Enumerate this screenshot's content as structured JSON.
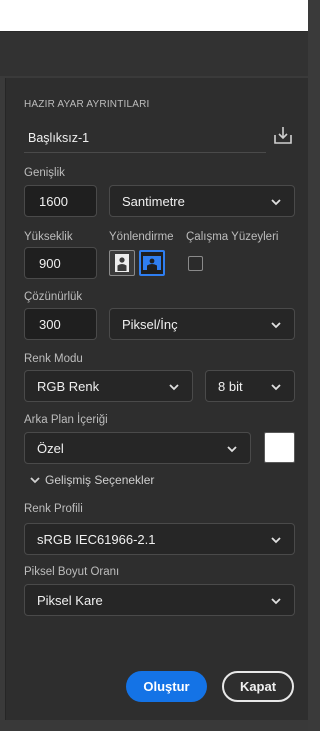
{
  "panel": {
    "section_title": "HAZIR AYAR AYRINTILARI",
    "document_name": "Başlıksız-1"
  },
  "width": {
    "label": "Genişlik",
    "value": "1600",
    "unit": "Santimetre"
  },
  "height": {
    "label": "Yükseklik",
    "value": "900"
  },
  "orientation": {
    "label": "Yönlendirme",
    "selected": "landscape"
  },
  "artboards": {
    "label": "Çalışma Yüzeyleri",
    "checked": false
  },
  "resolution": {
    "label": "Çözünürlük",
    "value": "300",
    "unit": "Piksel/İnç"
  },
  "color_mode": {
    "label": "Renk Modu",
    "mode": "RGB Renk",
    "depth": "8 bit"
  },
  "background": {
    "label": "Arka Plan İçeriği",
    "value": "Özel",
    "swatch_color": "#ffffff"
  },
  "advanced": {
    "label": "Gelişmiş Seçenekler"
  },
  "color_profile": {
    "label": "Renk Profili",
    "value": "sRGB IEC61966-2.1"
  },
  "pixel_aspect": {
    "label": "Piksel Boyut Oranı",
    "value": "Piksel Kare"
  },
  "buttons": {
    "create": "Oluştur",
    "close": "Kapat"
  },
  "colors": {
    "accent": "#1473e6",
    "panel_bg": "#2e2e2e",
    "field_bg": "#1f1f1f"
  }
}
